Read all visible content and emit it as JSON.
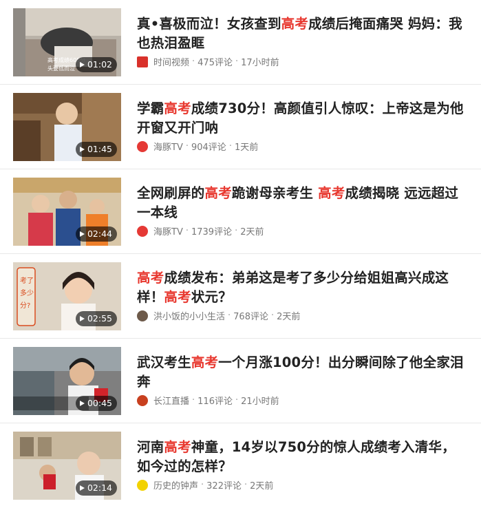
{
  "items": [
    {
      "title_parts": [
        {
          "text": "真•喜极而泣！女孩查到",
          "hl": false
        },
        {
          "text": "高考",
          "hl": true
        },
        {
          "text": "成绩后掩面痛哭 妈妈：我也热泪盈眶",
          "hl": false
        }
      ],
      "source": "时间视频",
      "comments": "475评论",
      "time": "17小时前",
      "duration": "01:02",
      "thumb_caption": "高考成绩605分 头要低而泣"
    },
    {
      "title_parts": [
        {
          "text": "学霸",
          "hl": false
        },
        {
          "text": "高考",
          "hl": true
        },
        {
          "text": "成绩730分！高颜值引人惊叹：上帝这是为他开窗又开门呐",
          "hl": false
        }
      ],
      "source": "海豚TV",
      "comments": "904评论",
      "time": "1天前",
      "duration": "01:45",
      "thumb_caption": ""
    },
    {
      "title_parts": [
        {
          "text": "全网刷屏的",
          "hl": false
        },
        {
          "text": "高考",
          "hl": true
        },
        {
          "text": "跪谢母亲考生 ",
          "hl": false
        },
        {
          "text": "高考",
          "hl": true
        },
        {
          "text": "成绩揭晓 远远超过一本线",
          "hl": false
        }
      ],
      "source": "海豚TV",
      "comments": "1739评论",
      "time": "2天前",
      "duration": "02:44",
      "thumb_caption": ""
    },
    {
      "title_parts": [
        {
          "text": "高考",
          "hl": true
        },
        {
          "text": "成绩发布：弟弟这是考了多少分给姐姐高兴成这样！",
          "hl": false
        },
        {
          "text": "高考",
          "hl": true
        },
        {
          "text": "状元？",
          "hl": false
        }
      ],
      "source": "洪小饭的小小生活",
      "comments": "768评论",
      "time": "2天前",
      "duration": "02:55",
      "thumb_caption": "考了多少分?"
    },
    {
      "title_parts": [
        {
          "text": "武汉考生",
          "hl": false
        },
        {
          "text": "高考",
          "hl": true
        },
        {
          "text": "一个月涨100分！出分瞬间除了他全家泪奔",
          "hl": false
        }
      ],
      "source": "长江直播",
      "comments": "116评论",
      "time": "21小时前",
      "duration": "00:45",
      "thumb_caption": ""
    },
    {
      "title_parts": [
        {
          "text": "河南",
          "hl": false
        },
        {
          "text": "高考",
          "hl": true
        },
        {
          "text": "神童，14岁以750分的惊人成绩考入清华，如今过的怎样？",
          "hl": false
        }
      ],
      "source": "历史的钟声",
      "comments": "322评论",
      "time": "2天前",
      "duration": "02:14",
      "thumb_caption": ""
    }
  ],
  "colors": {
    "highlight": "#e8382f",
    "title": "#222222",
    "meta": "#777777",
    "source_icons": [
      "#d9312b",
      "#e53935",
      "#e53935",
      "#6d5a4a",
      "#c8401f",
      "#f2d200"
    ]
  },
  "icons": [
    "play-icon",
    "source-avatar-icon"
  ]
}
